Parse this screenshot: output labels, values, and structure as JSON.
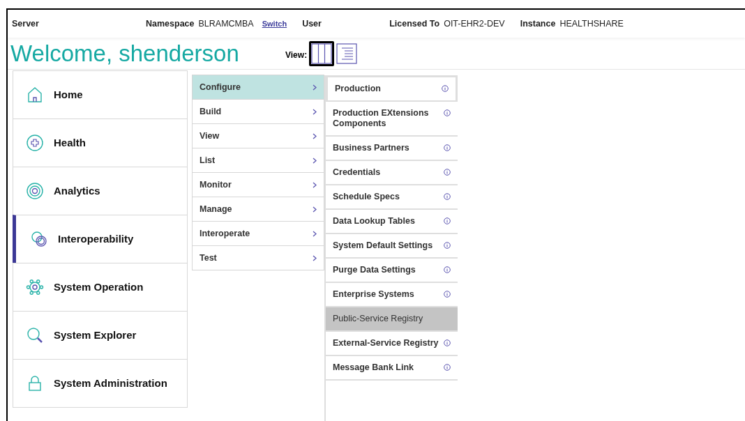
{
  "header": {
    "fields": [
      {
        "label": "Server"
      },
      {
        "label": "Namespace",
        "value": "BLRAMCMBA",
        "link": "Switch"
      },
      {
        "label": "User"
      },
      {
        "label": "Licensed To",
        "value": "OIT-EHR2-DEV"
      },
      {
        "label": "Instance",
        "value": "HEALTHSHARE"
      }
    ]
  },
  "welcome": "Welcome, shenderson",
  "view": {
    "label": "View:",
    "options": [
      {
        "kind": "columns",
        "selected": true
      },
      {
        "kind": "list",
        "selected": false
      }
    ]
  },
  "sidebar": {
    "items": [
      {
        "label": "Home",
        "selected": false
      },
      {
        "label": "Health",
        "selected": false
      },
      {
        "label": "Analytics",
        "selected": false
      },
      {
        "label": "Interoperability",
        "selected": true
      },
      {
        "label": "System Operation",
        "selected": false
      },
      {
        "label": "System Explorer",
        "selected": false
      },
      {
        "label": "System Administration",
        "selected": false
      }
    ]
  },
  "menu": {
    "items": [
      {
        "label": "Configure",
        "selected": true
      },
      {
        "label": "Build",
        "selected": false
      },
      {
        "label": "View",
        "selected": false
      },
      {
        "label": "List",
        "selected": false
      },
      {
        "label": "Monitor",
        "selected": false
      },
      {
        "label": "Manage",
        "selected": false
      },
      {
        "label": "Interoperate",
        "selected": false
      },
      {
        "label": "Test",
        "selected": false
      }
    ]
  },
  "submenu": {
    "items": [
      {
        "label": "Production",
        "selected": true,
        "disabled": false
      },
      {
        "label": "Production EXtensions Components",
        "selected": false,
        "disabled": false
      },
      {
        "label": "Business Partners",
        "selected": false,
        "disabled": false
      },
      {
        "label": "Credentials",
        "selected": false,
        "disabled": false
      },
      {
        "label": "Schedule Specs",
        "selected": false,
        "disabled": false
      },
      {
        "label": "Data Lookup Tables",
        "selected": false,
        "disabled": false
      },
      {
        "label": "System Default Settings",
        "selected": false,
        "disabled": false
      },
      {
        "label": "Purge Data Settings",
        "selected": false,
        "disabled": false
      },
      {
        "label": "Enterprise Systems",
        "selected": false,
        "disabled": false
      },
      {
        "label": "Public-Service Registry",
        "selected": false,
        "disabled": true
      },
      {
        "label": "External-Service Registry",
        "selected": false,
        "disabled": false
      },
      {
        "label": "Message Bank Link",
        "selected": false,
        "disabled": false
      }
    ]
  }
}
